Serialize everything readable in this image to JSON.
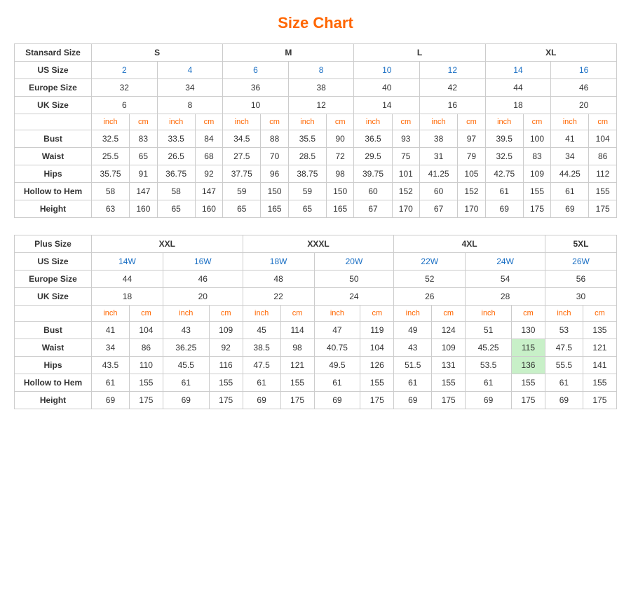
{
  "title": "Size Chart",
  "standard": {
    "headers": {
      "col1": "Stansard Size",
      "s": "S",
      "m": "M",
      "l": "L",
      "xl": "XL"
    },
    "us_size": {
      "label": "US Size",
      "values": [
        "2",
        "4",
        "6",
        "8",
        "10",
        "12",
        "14",
        "16"
      ]
    },
    "europe_size": {
      "label": "Europe Size",
      "values": [
        "32",
        "34",
        "36",
        "38",
        "40",
        "42",
        "44",
        "46"
      ]
    },
    "uk_size": {
      "label": "UK Size",
      "values": [
        "6",
        "8",
        "10",
        "12",
        "14",
        "16",
        "18",
        "20"
      ]
    },
    "units": [
      "inch",
      "cm",
      "inch",
      "cm",
      "inch",
      "cm",
      "inch",
      "cm",
      "inch",
      "cm",
      "inch",
      "cm",
      "inch",
      "cm",
      "inch",
      "cm"
    ],
    "bust": {
      "label": "Bust",
      "values": [
        "32.5",
        "83",
        "33.5",
        "84",
        "34.5",
        "88",
        "35.5",
        "90",
        "36.5",
        "93",
        "38",
        "97",
        "39.5",
        "100",
        "41",
        "104"
      ]
    },
    "waist": {
      "label": "Waist",
      "values": [
        "25.5",
        "65",
        "26.5",
        "68",
        "27.5",
        "70",
        "28.5",
        "72",
        "29.5",
        "75",
        "31",
        "79",
        "32.5",
        "83",
        "34",
        "86"
      ]
    },
    "hips": {
      "label": "Hips",
      "values": [
        "35.75",
        "91",
        "36.75",
        "92",
        "37.75",
        "96",
        "38.75",
        "98",
        "39.75",
        "101",
        "41.25",
        "105",
        "42.75",
        "109",
        "44.25",
        "112"
      ]
    },
    "hollow": {
      "label": "Hollow to Hem",
      "values": [
        "58",
        "147",
        "58",
        "147",
        "59",
        "150",
        "59",
        "150",
        "60",
        "152",
        "60",
        "152",
        "61",
        "155",
        "61",
        "155"
      ]
    },
    "height": {
      "label": "Height",
      "values": [
        "63",
        "160",
        "65",
        "160",
        "65",
        "165",
        "65",
        "165",
        "67",
        "170",
        "67",
        "170",
        "69",
        "175",
        "69",
        "175"
      ]
    }
  },
  "plus": {
    "headers": {
      "col1": "Plus Size",
      "xxl": "XXL",
      "xxxl": "XXXL",
      "4xl": "4XL",
      "5xl": "5XL"
    },
    "us_size": {
      "label": "US Size",
      "values": [
        "14W",
        "16W",
        "18W",
        "20W",
        "22W",
        "24W",
        "26W"
      ]
    },
    "europe_size": {
      "label": "Europe Size",
      "values": [
        "44",
        "46",
        "48",
        "50",
        "52",
        "54",
        "56"
      ]
    },
    "uk_size": {
      "label": "UK Size",
      "values": [
        "18",
        "20",
        "22",
        "24",
        "26",
        "28",
        "30"
      ]
    },
    "units": [
      "inch",
      "cm",
      "inch",
      "cm",
      "inch",
      "cm",
      "inch",
      "cm",
      "inch",
      "cm",
      "inch",
      "cm",
      "inch",
      "cm"
    ],
    "bust": {
      "label": "Bust",
      "values": [
        "41",
        "104",
        "43",
        "109",
        "45",
        "114",
        "47",
        "119",
        "49",
        "124",
        "51",
        "130",
        "53",
        "135"
      ]
    },
    "waist": {
      "label": "Waist",
      "values": [
        "34",
        "86",
        "36.25",
        "92",
        "38.5",
        "98",
        "40.75",
        "104",
        "43",
        "109",
        "45.25",
        "115",
        "47.5",
        "121"
      ]
    },
    "hips": {
      "label": "Hips",
      "values": [
        "43.5",
        "110",
        "45.5",
        "116",
        "47.5",
        "121",
        "49.5",
        "126",
        "51.5",
        "131",
        "53.5",
        "136",
        "55.5",
        "141"
      ]
    },
    "hollow": {
      "label": "Hollow to Hem",
      "values": [
        "61",
        "155",
        "61",
        "155",
        "61",
        "155",
        "61",
        "155",
        "61",
        "155",
        "61",
        "155",
        "61",
        "155"
      ]
    },
    "height": {
      "label": "Height",
      "values": [
        "69",
        "175",
        "69",
        "175",
        "69",
        "175",
        "69",
        "175",
        "69",
        "175",
        "69",
        "175",
        "69",
        "175"
      ]
    }
  }
}
